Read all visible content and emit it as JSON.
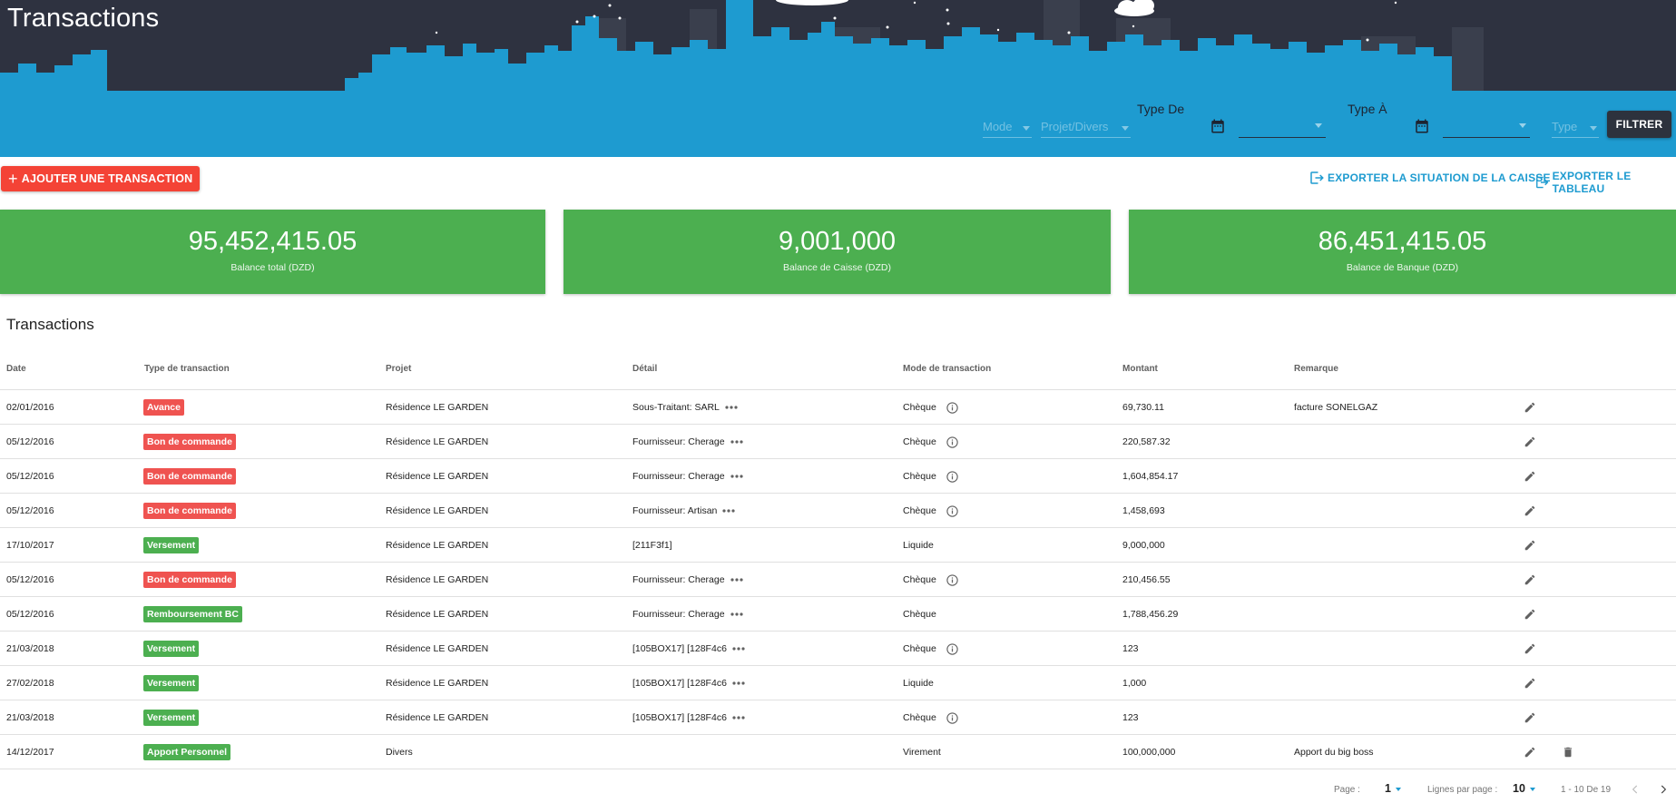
{
  "page": {
    "title": "Transactions"
  },
  "filters": {
    "mode_placeholder": "Mode",
    "projet_placeholder": "Projet/Divers",
    "type_de_label": "Type De",
    "type_a_label": "Type À",
    "type_placeholder": "Type",
    "filter_button": "FILTRER"
  },
  "actions": {
    "add_button": "AJOUTER UNE TRANSACTION",
    "export_caisse": "EXPORTER LA SITUATION DE LA CAISSE",
    "export_table": "EXPORTER LE TABLEAU"
  },
  "cards": [
    {
      "value": "95,452,415.05",
      "label": "Balance total (DZD)"
    },
    {
      "value": "9,001,000",
      "label": "Balance de Caisse (DZD)"
    },
    {
      "value": "86,451,415.05",
      "label": "Balance de Banque (DZD)"
    }
  ],
  "table": {
    "title": "Transactions",
    "headers": {
      "date": "Date",
      "type": "Type de transaction",
      "projet": "Projet",
      "detail": "Détail",
      "mode": "Mode de transaction",
      "montant": "Montant",
      "remarque": "Remarque"
    },
    "rows": [
      {
        "date": "02/01/2016",
        "type": "Avance",
        "type_color": "red",
        "projet": "Résidence LE GARDEN",
        "detail": "Sous-Traitant: SARL",
        "more": true,
        "mode": "Chèque",
        "info": true,
        "montant": "69,730.11",
        "remarque": "facture SONELGAZ",
        "delete": false
      },
      {
        "date": "05/12/2016",
        "type": "Bon de commande",
        "type_color": "red",
        "projet": "Résidence LE GARDEN",
        "detail": "Fournisseur: Cherage",
        "more": true,
        "mode": "Chèque",
        "info": true,
        "montant": "220,587.32",
        "remarque": "",
        "delete": false
      },
      {
        "date": "05/12/2016",
        "type": "Bon de commande",
        "type_color": "red",
        "projet": "Résidence LE GARDEN",
        "detail": "Fournisseur: Cherage",
        "more": true,
        "mode": "Chèque",
        "info": true,
        "montant": "1,604,854.17",
        "remarque": "",
        "delete": false
      },
      {
        "date": "05/12/2016",
        "type": "Bon de commande",
        "type_color": "red",
        "projet": "Résidence LE GARDEN",
        "detail": "Fournisseur: Artisan",
        "more": true,
        "mode": "Chèque",
        "info": true,
        "montant": "1,458,693",
        "remarque": "",
        "delete": false
      },
      {
        "date": "17/10/2017",
        "type": "Versement",
        "type_color": "green",
        "projet": "Résidence LE GARDEN",
        "detail": "[211F3f1]",
        "more": false,
        "mode": "Liquide",
        "info": false,
        "montant": "9,000,000",
        "remarque": "",
        "delete": false
      },
      {
        "date": "05/12/2016",
        "type": "Bon de commande",
        "type_color": "red",
        "projet": "Résidence LE GARDEN",
        "detail": "Fournisseur: Cherage",
        "more": true,
        "mode": "Chèque",
        "info": true,
        "montant": "210,456.55",
        "remarque": "",
        "delete": false
      },
      {
        "date": "05/12/2016",
        "type": "Remboursement BC",
        "type_color": "green",
        "projet": "Résidence LE GARDEN",
        "detail": "Fournisseur: Cherage",
        "more": true,
        "mode": "Chèque",
        "info": false,
        "montant": "1,788,456.29",
        "remarque": "",
        "delete": false
      },
      {
        "date": "21/03/2018",
        "type": "Versement",
        "type_color": "green",
        "projet": "Résidence LE GARDEN",
        "detail": "[105BOX17] [128F4c6",
        "more": true,
        "mode": "Chèque",
        "info": true,
        "montant": "123",
        "remarque": "",
        "delete": false
      },
      {
        "date": "27/02/2018",
        "type": "Versement",
        "type_color": "green",
        "projet": "Résidence LE GARDEN",
        "detail": "[105BOX17] [128F4c6",
        "more": true,
        "mode": "Liquide",
        "info": false,
        "montant": "1,000",
        "remarque": "",
        "delete": false
      },
      {
        "date": "21/03/2018",
        "type": "Versement",
        "type_color": "green",
        "projet": "Résidence LE GARDEN",
        "detail": "[105BOX17] [128F4c6",
        "more": true,
        "mode": "Chèque",
        "info": true,
        "montant": "123",
        "remarque": "",
        "delete": false
      },
      {
        "date": "14/12/2017",
        "type": "Apport Personnel",
        "type_color": "green",
        "projet": "Divers",
        "detail": "",
        "more": false,
        "mode": "Virement",
        "info": false,
        "montant": "100,000,000",
        "remarque": "Apport du big boss",
        "delete": true
      }
    ]
  },
  "pagination": {
    "page_label": "Page :",
    "page_value": "1",
    "rows_label": "Lignes par page :",
    "rows_value": "10",
    "range": "1 - 10 De 19"
  },
  "colors": {
    "header_dark": "#2e3240",
    "skyline_blue": "#1e9bd0",
    "danger": "#f44336",
    "success": "#4caf50",
    "link": "#1e9bd0"
  }
}
